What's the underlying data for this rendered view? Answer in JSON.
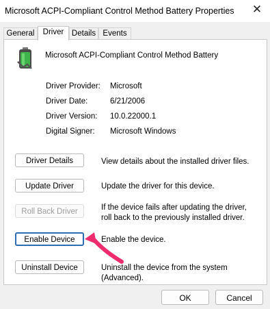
{
  "window": {
    "title": "Microsoft ACPI-Compliant Control Method Battery Properties",
    "close_glyph": "✕"
  },
  "tabs": [
    {
      "label": "General",
      "active": false
    },
    {
      "label": "Driver",
      "active": true
    },
    {
      "label": "Details",
      "active": false
    },
    {
      "label": "Events",
      "active": false
    }
  ],
  "device": {
    "name": "Microsoft ACPI-Compliant Control Method Battery",
    "icon": "battery-icon"
  },
  "driver_info": [
    {
      "label": "Driver Provider:",
      "value": "Microsoft"
    },
    {
      "label": "Driver Date:",
      "value": "6/21/2006"
    },
    {
      "label": "Driver Version:",
      "value": "10.0.22000.1"
    },
    {
      "label": "Digital Signer:",
      "value": "Microsoft Windows"
    }
  ],
  "actions": [
    {
      "label": "Driver Details",
      "description": "View details about the installed driver files.",
      "enabled": true
    },
    {
      "label": "Update Driver",
      "description": "Update the driver for this device.",
      "enabled": true
    },
    {
      "label": "Roll Back Driver",
      "description": "If the device fails after updating the driver, roll back to the previously installed driver.",
      "enabled": false
    },
    {
      "label": "Enable Device",
      "description": "Enable the device.",
      "enabled": true,
      "highlighted": true
    },
    {
      "label": "Uninstall Device",
      "description": "Uninstall the device from the system (Advanced).",
      "enabled": true
    }
  ],
  "footer": {
    "ok_label": "OK",
    "cancel_label": "Cancel"
  },
  "colors": {
    "accent_border": "#2e6cb5",
    "annotation_arrow": "#ee2b6c"
  }
}
